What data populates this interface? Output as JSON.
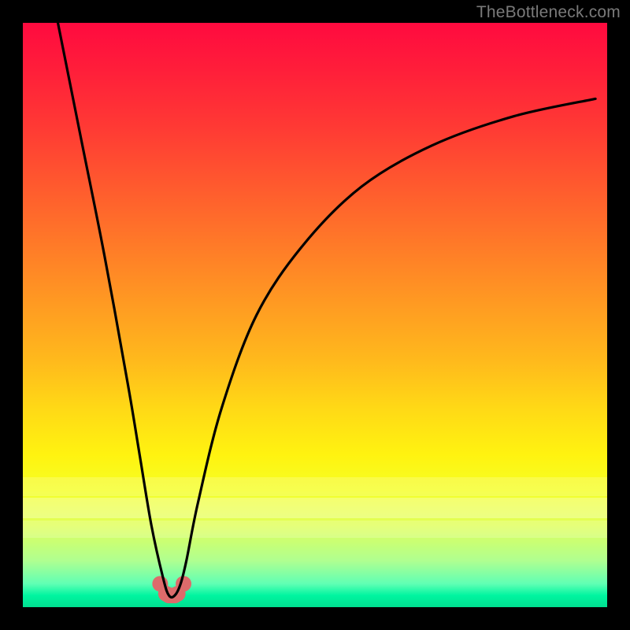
{
  "watermark": "TheBottleneck.com",
  "colors": {
    "frame": "#000000",
    "curve": "#000000",
    "marker": "#dd6b6b",
    "grad_top": "#ff0a3f",
    "grad_bottom": "#00e090"
  },
  "chart_data": {
    "type": "line",
    "title": "",
    "xlabel": "",
    "ylabel": "",
    "xlim": [
      0,
      100
    ],
    "ylim": [
      0,
      100
    ],
    "grid": false,
    "legend": false,
    "series": [
      {
        "name": "bottleneck-curve",
        "x": [
          6,
          10,
          14,
          18,
          20,
          22,
          24,
          25,
          26,
          27,
          28,
          30,
          34,
          40,
          48,
          58,
          70,
          84,
          98
        ],
        "values": [
          100,
          80,
          60,
          38,
          26,
          14,
          5,
          2,
          2,
          4,
          8,
          18,
          34,
          50,
          62,
          72,
          79,
          84,
          87
        ]
      }
    ],
    "markers": {
      "name": "highlight-dots",
      "x": [
        23.5,
        24.5,
        25.0,
        25.5,
        26.0,
        26.5,
        27.5
      ],
      "values": [
        4.0,
        2.3,
        2.0,
        2.0,
        2.0,
        2.3,
        4.0
      ],
      "color": "#dd6b6b",
      "radius": 10
    },
    "background_gradient": {
      "top": "red-pink",
      "middle": "orange-yellow",
      "bottom": "green"
    }
  }
}
